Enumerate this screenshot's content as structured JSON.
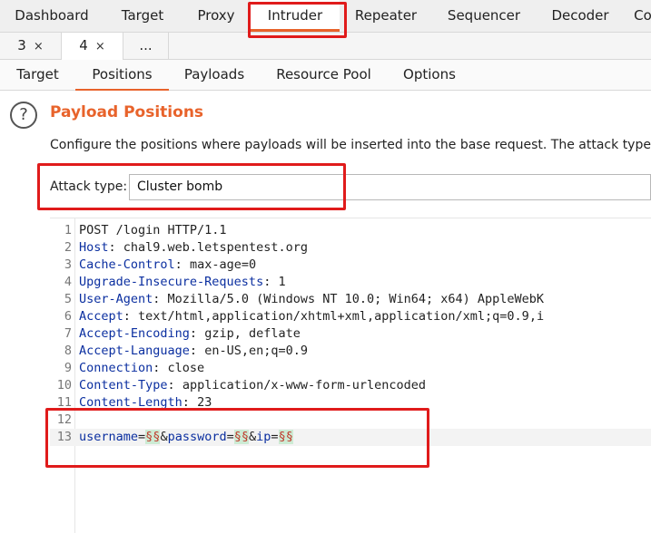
{
  "top_tabs": [
    "Dashboard",
    "Target",
    "Proxy",
    "Intruder",
    "Repeater",
    "Sequencer",
    "Decoder",
    "Co"
  ],
  "sub_tabs": [
    {
      "label": "3",
      "close": "×"
    },
    {
      "label": "4",
      "close": "×"
    },
    {
      "label": "..."
    }
  ],
  "section_tabs": [
    "Target",
    "Positions",
    "Payloads",
    "Resource Pool",
    "Options"
  ],
  "help_icon_glyph": "?",
  "section": {
    "title": "Payload Positions",
    "description": "Configure the positions where payloads will be inserted into the base request. The attack type de"
  },
  "attack": {
    "label": "Attack type:",
    "value": "Cluster bomb"
  },
  "request_lines": [
    {
      "n": "1",
      "plain": "POST /login HTTP/1.1"
    },
    {
      "n": "2",
      "name": "Host",
      "sep": ": ",
      "value": "chal9.web.letspentest.org"
    },
    {
      "n": "3",
      "name": "Cache-Control",
      "sep": ": ",
      "value": "max-age=0"
    },
    {
      "n": "4",
      "name": "Upgrade-Insecure-Requests",
      "sep": ": ",
      "value": "1"
    },
    {
      "n": "5",
      "name": "User-Agent",
      "sep": ": ",
      "value": "Mozilla/5.0 (Windows NT 10.0; Win64; x64) AppleWebK"
    },
    {
      "n": "6",
      "name": "Accept",
      "sep": ": ",
      "value": "text/html,application/xhtml+xml,application/xml;q=0.9,i"
    },
    {
      "n": "7",
      "name": "Accept-Encoding",
      "sep": ": ",
      "value": "gzip, deflate"
    },
    {
      "n": "8",
      "name": "Accept-Language",
      "sep": ": ",
      "value": "en-US,en;q=0.9"
    },
    {
      "n": "9",
      "name": "Connection",
      "sep": ": ",
      "value": "close"
    },
    {
      "n": "10",
      "name": "Content-Type",
      "sep": ": ",
      "value": "application/x-www-form-urlencoded"
    },
    {
      "n": "11",
      "name": "Content-Length",
      "sep": ": ",
      "value": "23"
    },
    {
      "n": "12",
      "plain": ""
    }
  ],
  "body_line": {
    "n": "13",
    "parts": [
      {
        "t": "username",
        "k": "hname"
      },
      {
        "t": "=",
        "k": "plain"
      },
      {
        "t": "§§",
        "k": "marker"
      },
      {
        "t": "&",
        "k": "plain"
      },
      {
        "t": "password",
        "k": "hname"
      },
      {
        "t": "=",
        "k": "plain"
      },
      {
        "t": "§§",
        "k": "marker"
      },
      {
        "t": "&",
        "k": "plain"
      },
      {
        "t": "ip",
        "k": "hname"
      },
      {
        "t": "=",
        "k": "plain"
      },
      {
        "t": "§§",
        "k": "marker"
      }
    ]
  },
  "colors": {
    "accent": "#e8632b",
    "highlight": "#e01b1b",
    "header_name": "#0b2fa0",
    "payload_marker_bg": "#cdebd4"
  }
}
